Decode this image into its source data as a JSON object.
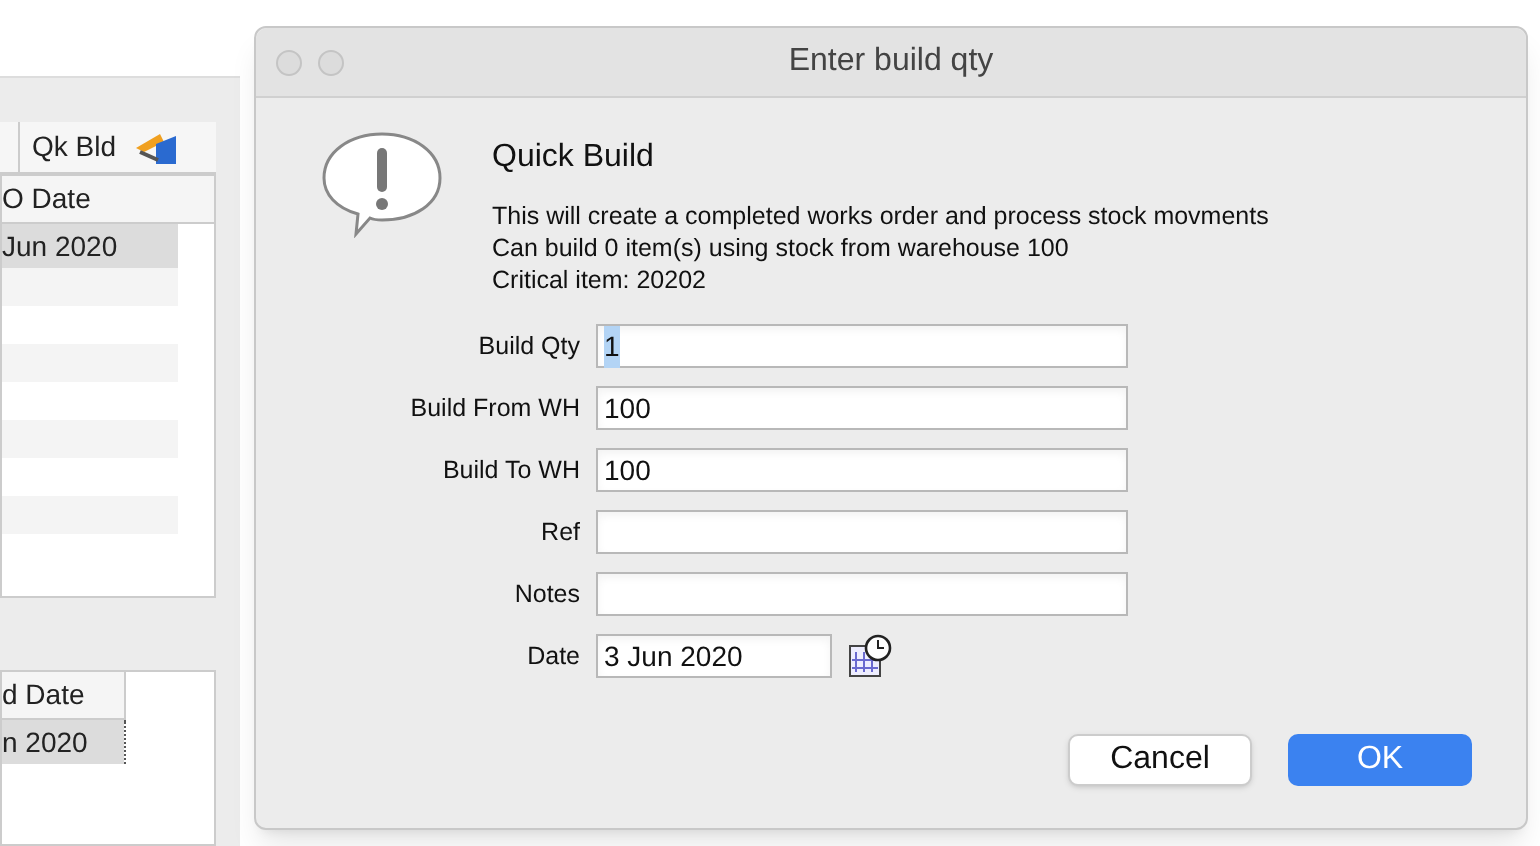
{
  "background_window": {
    "toolbar": {
      "label": "Qk Bld"
    },
    "table_1": {
      "column_header": "O Date",
      "rows": [
        {
          "cell": "Jun 2020",
          "selected": true
        }
      ]
    },
    "table_2": {
      "column_header": "d Date",
      "rows": [
        {
          "cell": "n 2020",
          "selected": true
        }
      ]
    }
  },
  "dialog": {
    "title": "Enter build qty",
    "heading": "Quick Build",
    "message": [
      "This will create a completed works order and process stock movments",
      "Can build 0 item(s) using stock from warehouse 100",
      "Critical item: 20202"
    ],
    "fields": [
      {
        "label": "Build Qty",
        "value": "1",
        "kind": "text",
        "value_selected": true
      },
      {
        "label": "Build From WH",
        "value": "100",
        "kind": "text"
      },
      {
        "label": "Build To WH",
        "value": "100",
        "kind": "text"
      },
      {
        "label": "Ref",
        "kind": "text"
      },
      {
        "label": "Notes",
        "kind": "text"
      },
      {
        "label": "Date",
        "value": "3 Jun 2020",
        "kind": "date"
      }
    ],
    "buttons": [
      {
        "label": "Cancel",
        "default": false
      },
      {
        "label": "OK",
        "default": true
      }
    ]
  }
}
